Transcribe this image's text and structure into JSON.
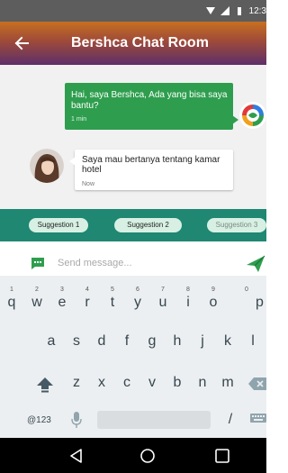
{
  "status_bar": {
    "time": "12:3"
  },
  "app_bar": {
    "title": "Bershca Chat Room"
  },
  "messages": [
    {
      "text": "Hai, saya Bershca, Ada yang bisa saya bantu?",
      "time": "1 min"
    },
    {
      "text": "Saya mau bertanya tentang kamar hotel",
      "time": "Now"
    }
  ],
  "suggestions": [
    "Suggestion 1",
    "Suggestion 2",
    "Suggestion 3"
  ],
  "input": {
    "placeholder": "Send message..."
  },
  "keyboard": {
    "row1": [
      "q",
      "w",
      "e",
      "r",
      "t",
      "y",
      "u",
      "i",
      "o",
      "p"
    ],
    "row1_numbers": [
      "1",
      "2",
      "3",
      "4",
      "5",
      "6",
      "7",
      "8",
      "9",
      "0"
    ],
    "row2": [
      "a",
      "s",
      "d",
      "f",
      "g",
      "h",
      "j",
      "k",
      "l"
    ],
    "row3": [
      "z",
      "x",
      "c",
      "v",
      "b",
      "n",
      "m"
    ],
    "symbols_key": "@123",
    "slash_key": "/"
  },
  "colors": {
    "app_bar_top": "#c7701f",
    "app_bar_bottom": "#5d2f6a",
    "bot_bubble": "#2e9e4e",
    "suggestion_bar": "#1f8772",
    "chip": "#d7f0e3",
    "send": "#2e9e4e"
  },
  "icons": {
    "back": "arrow-left",
    "bot_avatar": "bershca-logo",
    "user_avatar": "user-photo",
    "input": "chat-bubble",
    "send": "paper-plane",
    "nav": [
      "back-triangle",
      "home-circle",
      "recents-square"
    ]
  }
}
